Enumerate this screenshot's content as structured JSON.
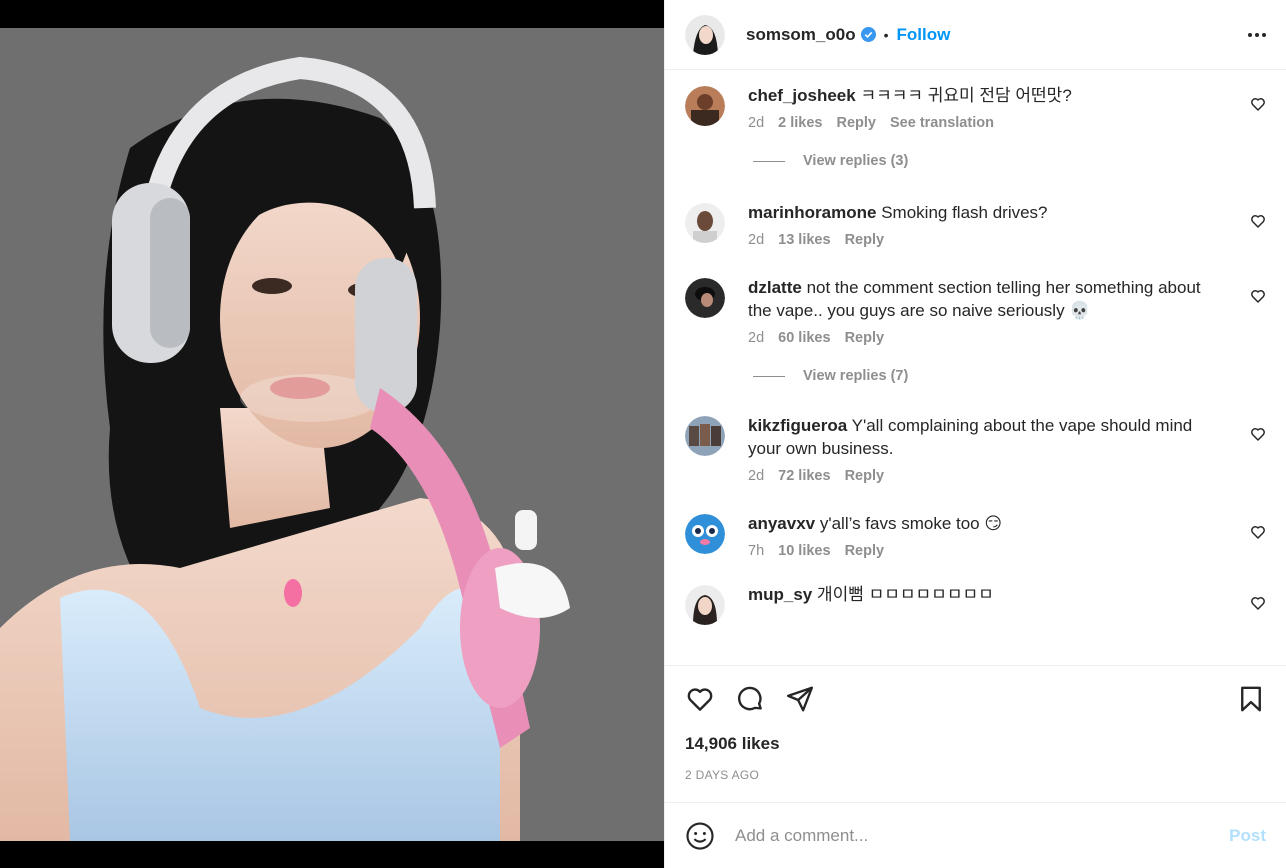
{
  "post": {
    "author": "somsom_o0o",
    "follow_label": "Follow",
    "separator": "•",
    "likes_text": "14,906 likes",
    "time_ago": "2 DAYS AGO"
  },
  "comments": [
    {
      "user": "chef_josheek",
      "text": "ㅋㅋㅋㅋ 귀요미 전담 어떤맛?",
      "age": "2d",
      "likes": "2 likes",
      "reply": "Reply",
      "translate": "See translation",
      "view_replies": "View replies (3)"
    },
    {
      "user": "marinhoramone",
      "text": "Smoking flash drives?",
      "age": "2d",
      "likes": "13 likes",
      "reply": "Reply"
    },
    {
      "user": "dzlatte",
      "text": "not the comment section telling her something about the vape.. you guys are so naive seriously 💀",
      "age": "2d",
      "likes": "60 likes",
      "reply": "Reply",
      "view_replies": "View replies (7)"
    },
    {
      "user": "kikzfigueroa",
      "text": "Y'all complaining about the vape should mind your own business.",
      "age": "2d",
      "likes": "72 likes",
      "reply": "Reply"
    },
    {
      "user": "anyavxv",
      "text": "y'all’s favs smoke too 😏",
      "age": "7h",
      "likes": "10 likes",
      "reply": "Reply"
    },
    {
      "user": "mup_sy",
      "text": "개이뻠 ㅁㅁㅁㅁㅁㅁㅁㅁ"
    }
  ],
  "add_comment": {
    "placeholder": "Add a comment...",
    "post_label": "Post"
  },
  "colors": {
    "accent": "#0095f6",
    "post_disabled": "#b2dffc",
    "muted": "#8e8e8e"
  },
  "icons": [
    "heart-icon",
    "comment-icon",
    "share-icon",
    "bookmark-icon",
    "emoji-icon",
    "verified-icon",
    "more-icon"
  ]
}
